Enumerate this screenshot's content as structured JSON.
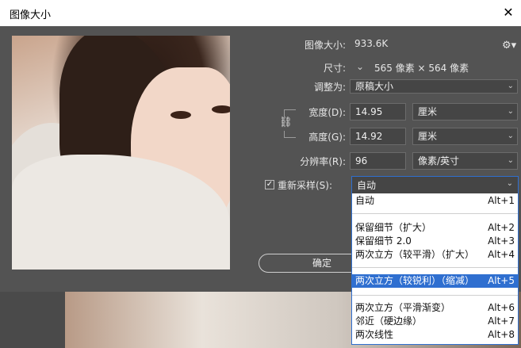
{
  "window": {
    "title": "图像大小"
  },
  "image_size": {
    "label": "图像大小:",
    "value": "933.6K"
  },
  "dimensions": {
    "label": "尺寸:",
    "value": "565 像素 × 564 像素"
  },
  "fit_to": {
    "label": "调整为:",
    "value": "原稿大小"
  },
  "width": {
    "label": "宽度(D):",
    "value": "14.95",
    "unit": "厘米"
  },
  "height": {
    "label": "高度(G):",
    "value": "14.92",
    "unit": "厘米"
  },
  "resolution": {
    "label": "分辨率(R):",
    "value": "96",
    "unit": "像素/英寸"
  },
  "resample": {
    "label": "重新采样(S):",
    "checked": true,
    "value": "自动"
  },
  "ok_button": "确定",
  "resample_menu": [
    {
      "label": "自动",
      "shortcut": "Alt+1"
    },
    {
      "label": "保留细节（扩大）",
      "shortcut": "Alt+2"
    },
    {
      "label": "保留细节 2.0",
      "shortcut": "Alt+3"
    },
    {
      "label": "两次立方（较平滑）（扩大）",
      "shortcut": "Alt+4"
    },
    {
      "label": "两次立方（较锐利）（缩减）",
      "shortcut": "Alt+5",
      "highlighted": true
    },
    {
      "label": "两次立方（平滑渐变）",
      "shortcut": "Alt+6"
    },
    {
      "label": "邻近（硬边缘）",
      "shortcut": "Alt+7"
    },
    {
      "label": "两次线性",
      "shortcut": "Alt+8"
    }
  ],
  "colors": {
    "dialog_bg": "#535353",
    "highlight": "#2f6fd0",
    "field_bg": "#454545"
  }
}
